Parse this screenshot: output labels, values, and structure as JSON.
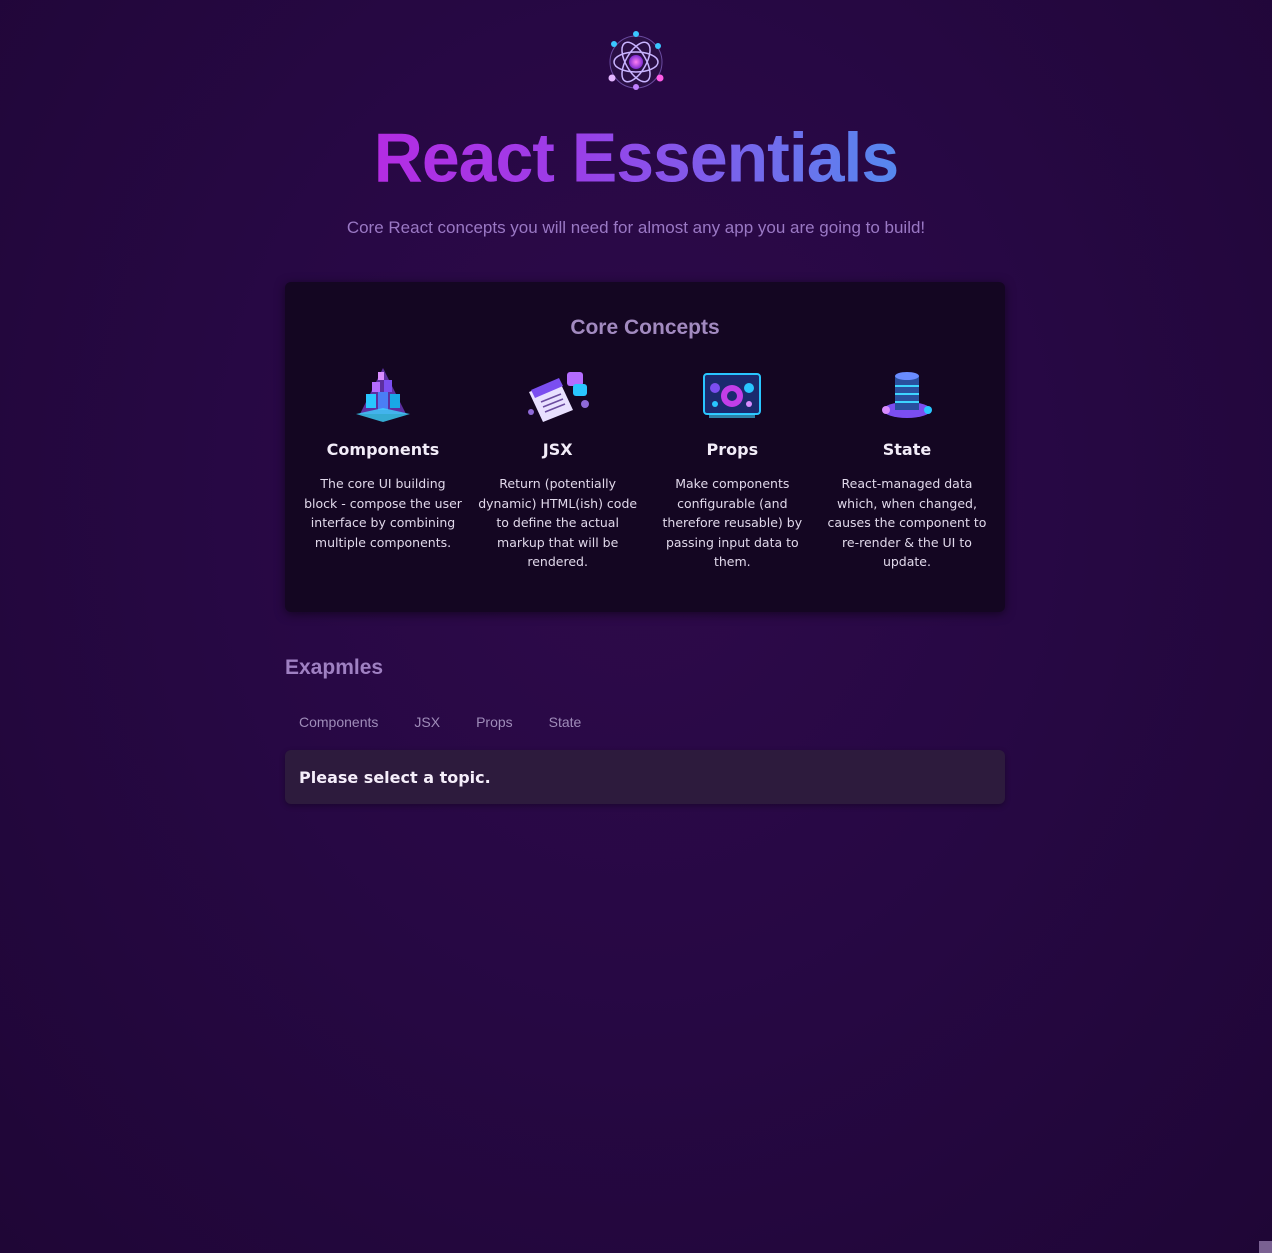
{
  "header": {
    "logo_icon": "atom-icon",
    "title": "React Essentials",
    "subtitle": "Core React concepts you will need for almost any app you are going to build!",
    "title_gradient": [
      "#e30ad9",
      "#9b3ee8",
      "#3ca4f2",
      "#12d6f5"
    ]
  },
  "core_concepts": {
    "heading": "Core Concepts",
    "items": [
      {
        "icon": "components-icon",
        "title": "Components",
        "description": "The core UI building block - compose the user interface by combining multiple components."
      },
      {
        "icon": "jsx-icon",
        "title": "JSX",
        "description": "Return (potentially dynamic) HTML(ish) code to define the actual markup that will be rendered."
      },
      {
        "icon": "props-icon",
        "title": "Props",
        "description": "Make components configurable (and therefore reusable) by passing input data to them."
      },
      {
        "icon": "state-icon",
        "title": "State",
        "description": "React-managed data which, when changed, causes the component to re-render & the UI to update."
      }
    ]
  },
  "examples": {
    "heading": "Exapmles",
    "tabs": [
      {
        "label": "Components"
      },
      {
        "label": "JSX"
      },
      {
        "label": "Props"
      },
      {
        "label": "State"
      }
    ],
    "placeholder": "Please select a topic."
  },
  "colors": {
    "background": "#270844",
    "card": "#140622",
    "tab_content": "#2d1b3d",
    "heading_muted": "#a28ac0"
  }
}
